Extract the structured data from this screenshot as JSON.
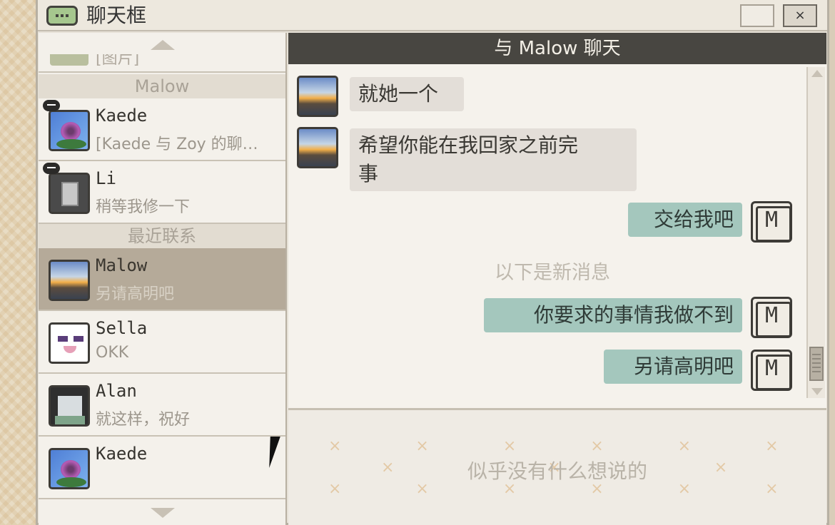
{
  "window": {
    "title": "聊天框",
    "close_label": "×",
    "app_icon": "chat-bubble-icon"
  },
  "sidebar": {
    "partial_preview": "[图片]",
    "section_malow": "Malow",
    "section_recent": "最近联系",
    "malow_group": [
      {
        "name": "Kaede",
        "preview": "[Kaede 与 Zoy 的聊…",
        "avatar": "flower",
        "badge": true
      },
      {
        "name": "Li",
        "preview": "稍等我修一下",
        "avatar": "grey-cube",
        "badge": true
      }
    ],
    "recent": [
      {
        "name": "Malow",
        "preview": "另请高明吧",
        "avatar": "sunset",
        "selected": true
      },
      {
        "name": "Sella",
        "preview": "OKK",
        "avatar": "panda"
      },
      {
        "name": "Alan",
        "preview": "就这样，祝好",
        "avatar": "robot"
      },
      {
        "name": "Kaede",
        "preview": "",
        "avatar": "flower"
      }
    ]
  },
  "chat": {
    "header": "与 Malow 聊天",
    "messages": [
      {
        "from": "other",
        "text": "就她一个"
      },
      {
        "from": "other",
        "text": "希望你能在我回家之前完\n事"
      },
      {
        "from": "self",
        "text": "交给我吧"
      },
      {
        "from": "self",
        "text": "你要求的事情我做不到"
      },
      {
        "from": "self",
        "text": "另请高明吧"
      }
    ],
    "new_messages_divider": "以下是新消息",
    "self_avatar_letter": "M",
    "input_placeholder": "似乎没有什么想说的"
  },
  "colors": {
    "header_bg": "#484641",
    "incoming_bubble": "#e3ded8",
    "outgoing_bubble": "#a4c7bd",
    "selected_contact": "#b5aa99"
  }
}
